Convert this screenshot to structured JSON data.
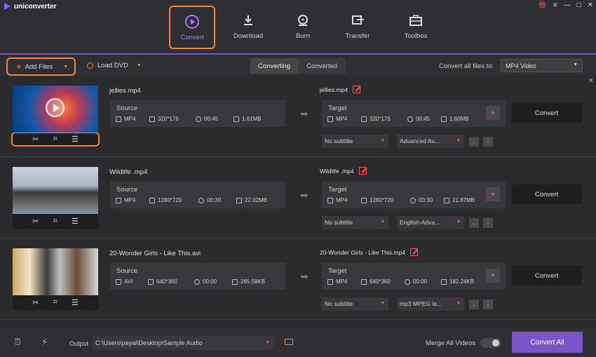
{
  "app": {
    "title": "uniconverter"
  },
  "nav": {
    "tabs": [
      {
        "label": "Convert",
        "icon": "convert-icon",
        "active": true
      },
      {
        "label": "Download",
        "icon": "download-icon"
      },
      {
        "label": "Burn",
        "icon": "burn-icon"
      },
      {
        "label": "Transfer",
        "icon": "transfer-icon"
      },
      {
        "label": "Toolbox",
        "icon": "toolbox-icon"
      }
    ]
  },
  "toolbar": {
    "add_files": "Add Files",
    "load_dvd": "Load DVD",
    "tab_converting": "Converting",
    "tab_converted": "Converted",
    "convert_all_to_label": "Convert all files to:",
    "format": "MP4 Video"
  },
  "files": [
    {
      "name": "jellies.mp4",
      "source": {
        "title": "Source",
        "format": "MP4",
        "resolution": "320*176",
        "duration": "00:45",
        "size": "1.61MB"
      },
      "target_name": "jellies.mp4",
      "target": {
        "title": "Target",
        "format": "MP4",
        "resolution": "320*176",
        "duration": "00:45",
        "size": "1.60MB"
      },
      "subtitle": "No subtitle",
      "audio": "Advanced Au...",
      "convert": "Convert"
    },
    {
      "name": "Wildlife .mp4",
      "source": {
        "title": "Source",
        "format": "MP4",
        "resolution": "1280*720",
        "duration": "00:30",
        "size": "22.02MB"
      },
      "target_name": "Wildlife .mp4",
      "target": {
        "title": "Target",
        "format": "MP4",
        "resolution": "1280*720",
        "duration": "00:30",
        "size": "21.87MB"
      },
      "subtitle": "No subtitle",
      "audio": "English-Adva...",
      "convert": "Convert"
    },
    {
      "name": "20-Wonder Girls - Like This.avi",
      "source": {
        "title": "Source",
        "format": "AVI",
        "resolution": "640*360",
        "duration": "00:00",
        "size": "265.58KB"
      },
      "target_name": "20-Wonder Girls - Like This.mp4",
      "target": {
        "title": "Target",
        "format": "MP4",
        "resolution": "640*360",
        "duration": "00:00",
        "size": "182.24KB"
      },
      "subtitle": "No subtitle",
      "audio": "mp3 MPEG la...",
      "convert": "Convert"
    }
  ],
  "footer": {
    "output_label": "Output",
    "output_path": "C:\\Users\\payal\\Desktop\\Sample Audio",
    "merge_label": "Merge All Videos",
    "convert_all": "Convert All"
  },
  "colors": {
    "accent": "#7b55c8",
    "highlight": "#f0873d",
    "danger": "#ff5a5a"
  }
}
